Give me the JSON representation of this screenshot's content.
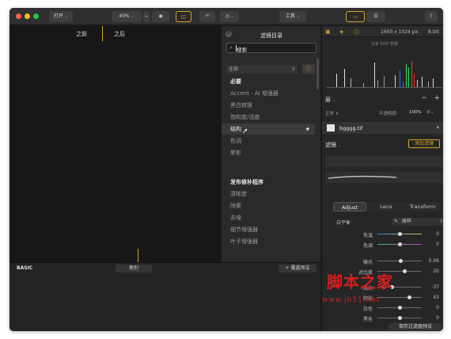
{
  "toolbar": {
    "open_label": "打开",
    "zoom_label": "40%",
    "tools_label": "工具"
  },
  "canvas": {
    "before_label": "之前",
    "after_label": "之后"
  },
  "filter_catalog": {
    "title": "滤镜目录",
    "search_value": "搜索",
    "category_value": "全部",
    "items": [
      {
        "label": "必要",
        "type": "head"
      },
      {
        "label": "Accent - AI 增强器",
        "type": "item"
      },
      {
        "label": "黑白转换",
        "type": "item"
      },
      {
        "label": "饱和度/活度",
        "type": "item"
      },
      {
        "label": "结构",
        "type": "selected"
      },
      {
        "label": "色调",
        "type": "item"
      },
      {
        "label": "晕影",
        "type": "item"
      },
      {
        "label": "发布修补程序",
        "type": "head"
      },
      {
        "label": "清晰度",
        "type": "item"
      },
      {
        "label": "除雾",
        "type": "item"
      },
      {
        "label": "去噪",
        "type": "item"
      },
      {
        "label": "细节增强器",
        "type": "item"
      },
      {
        "label": "叶子增强器",
        "type": "item"
      }
    ]
  },
  "bottom_strip": {
    "label": "BASIC",
    "category_button": "类别",
    "save_look_button": "+ 覆盖预设"
  },
  "image_info": {
    "dimensions": "1600 x 1024 px",
    "bit_depth": "8-bit",
    "exif_note": "没有 EXIF 数据"
  },
  "layers": {
    "title": "层",
    "blend_mode": "正常",
    "opacity_label": "不透明度:",
    "opacity_value": "100%",
    "layer_name": "bgggg.tif"
  },
  "filters": {
    "title": "滤镜",
    "add_button": "添加滤镜",
    "tabs": [
      "Adjust",
      "Lens",
      "Transform"
    ],
    "white_balance_label": "白平衡",
    "white_balance_value": "原样",
    "sliders": [
      {
        "label": "色温",
        "value": "0",
        "level": 0.5
      },
      {
        "label": "色调",
        "value": "0",
        "level": 0.5
      },
      {
        "label": "曝光",
        "value": "0.06",
        "level": 0.52
      },
      {
        "label": "对比度",
        "value": "20",
        "level": 0.6
      },
      {
        "label": "高光",
        "value": "-37",
        "level": 0.32
      },
      {
        "label": "阴影",
        "value": "43",
        "level": 0.72
      },
      {
        "label": "白色",
        "value": "0",
        "level": 0.5
      },
      {
        "label": "黑色",
        "value": "0",
        "level": 0.5
      }
    ],
    "save_preset_button": "保存过滤器预设"
  },
  "watermark": {
    "text": "脚本之家",
    "url": "www.jb51.net"
  },
  "colors": {
    "accent": "#d6a52a",
    "close": "#ff5f57",
    "minimize": "#febc2e",
    "zoom": "#28c840",
    "watermark": "#d81e1e"
  }
}
